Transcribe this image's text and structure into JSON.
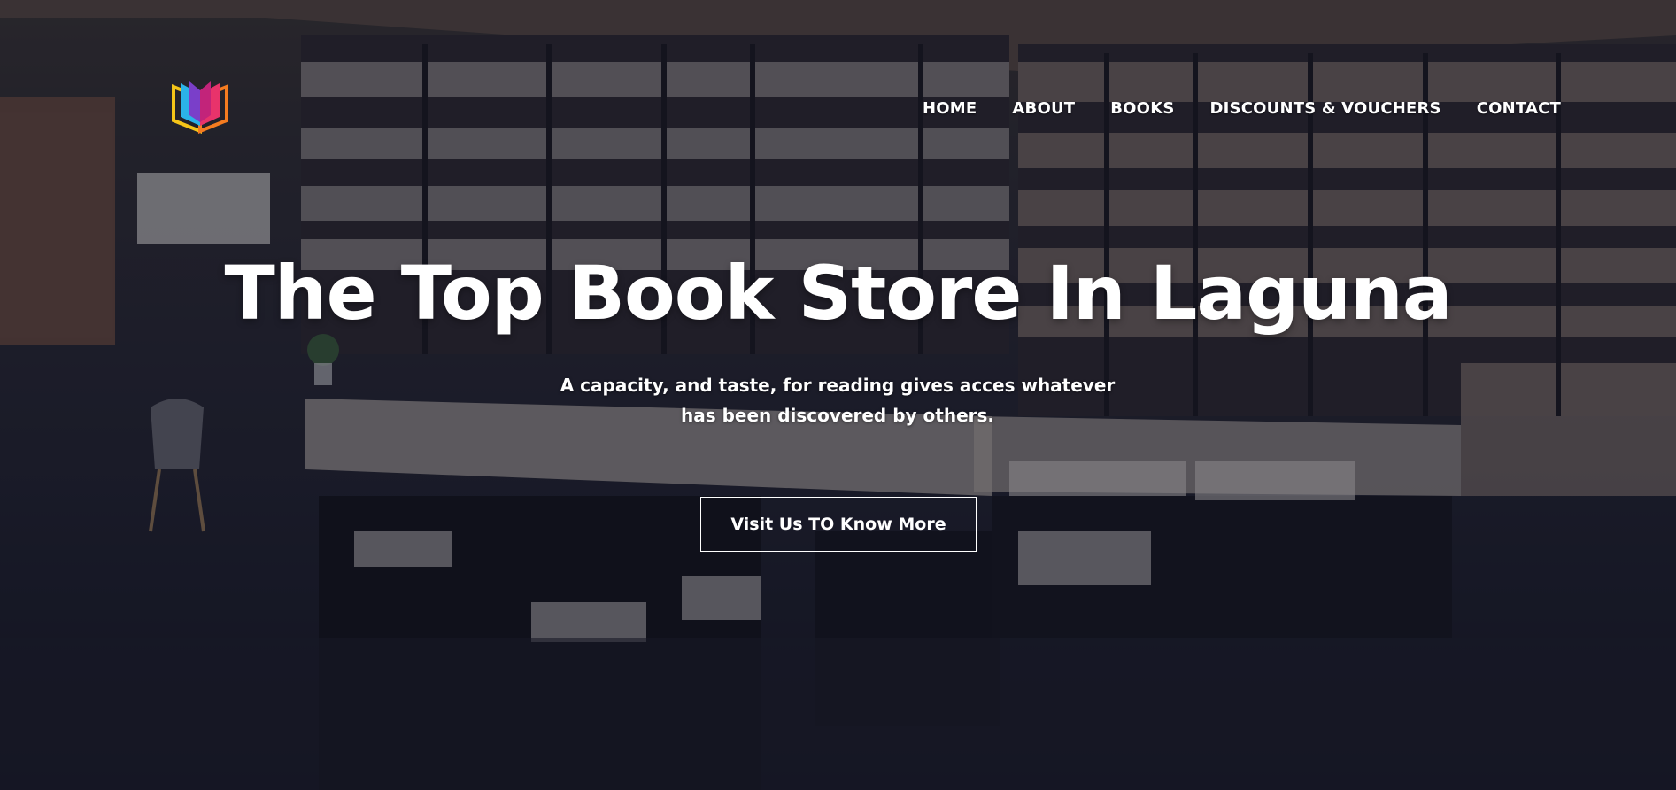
{
  "brand": {
    "logo_icon": "open-book-logo-icon",
    "logo_colors": [
      "#f5c518",
      "#2bb3e8",
      "#e8336b",
      "#7a3fc9",
      "#f57c20"
    ]
  },
  "nav": {
    "items": [
      {
        "label": "HOME"
      },
      {
        "label": "ABOUT"
      },
      {
        "label": "BOOKS"
      },
      {
        "label": "DISCOUNTS & VOUCHERS"
      },
      {
        "label": "CONTACT"
      }
    ]
  },
  "hero": {
    "title": "The Top Book Store In Laguna",
    "subtitle": "A capacity, and taste, for reading gives acces whatever has been discovered by others.",
    "cta_label": "Visit Us TO Know More"
  },
  "colors": {
    "text": "#ffffff",
    "overlay": "#141628"
  }
}
